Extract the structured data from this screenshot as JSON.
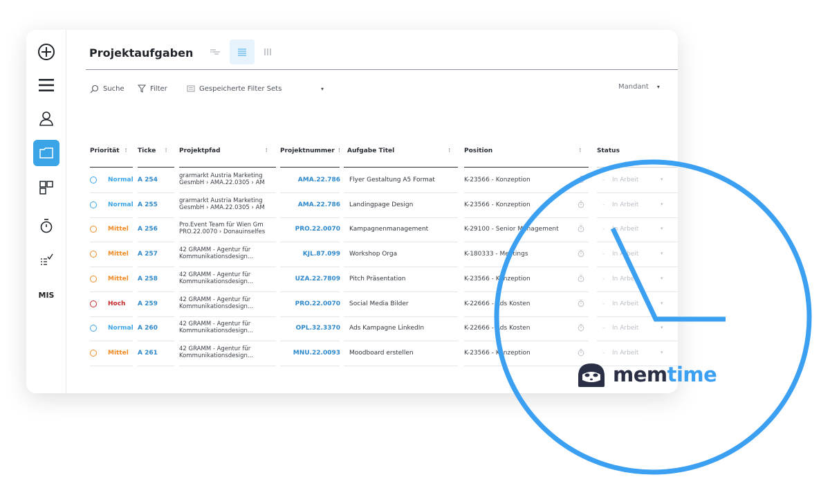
{
  "colors": {
    "accent": "#3aa4e6",
    "link": "#2d88cc",
    "normal": "#3aa4e6",
    "mittel": "#f08a24",
    "hoch": "#c62828",
    "brand_dark": "#2a2f45",
    "brand_blue": "#3b9ff2"
  },
  "sidebar": {
    "icons": [
      "add-circle-icon",
      "menu-icon",
      "user-icon",
      "folder-icon",
      "dashboard-icon",
      "stopwatch-icon",
      "checklist-icon"
    ],
    "mis_label": "MIS"
  },
  "header": {
    "title": "Projektaufgaben",
    "views": [
      "gantt-view-icon",
      "list-view-icon",
      "board-view-icon"
    ]
  },
  "toolbar": {
    "search_label": "Suche",
    "filter_label": "Filter",
    "saved_filters_label": "Gespeicherte Filter Sets",
    "saved_filters_caret": "▾",
    "mandant_label": "Mandant",
    "mandant_caret": "▾"
  },
  "table": {
    "sort_glyph": "⁝",
    "columns": [
      "Priorität",
      "Ticke",
      "Projektpfad",
      "Projektnummer",
      "Aufgabe Titel",
      "Position",
      "Status"
    ],
    "status_dash": "-",
    "caret": "▾",
    "rows": [
      {
        "priority": "Normal",
        "prio_key": "normal",
        "ticket": "A 254",
        "path1": "grarmarkt Austria Marketing",
        "path2": "GesmbH › AMA.22.0305 › AM",
        "pnum": "AMA.22.786",
        "task": "Flyer Gestaltung A5 Format",
        "position": "K-23566 - Konzeption",
        "status": "In Arbeit"
      },
      {
        "priority": "Normal",
        "prio_key": "normal",
        "ticket": "A 255",
        "path1": "grarmarkt Austria Marketing",
        "path2": "GesmbH › AMA.22.0305 › AM",
        "pnum": "AMA.22.786",
        "task": "Landingpage Design",
        "position": "K-23566 - Konzeption",
        "status": "In Arbeit"
      },
      {
        "priority": "Mittel",
        "prio_key": "mittel",
        "ticket": "A 256",
        "path1": "Pro.Event Team für Wien Gm",
        "path2": "PRO.22.0070 › Donauinselfes",
        "pnum": "PRO.22.0070",
        "task": "Kampagnenmanagement",
        "position": "K-29100 - Senior Management",
        "status": "In Arbeit"
      },
      {
        "priority": "Mittel",
        "prio_key": "mittel",
        "ticket": "A 257",
        "path1": "42 GRAMM - Agentur für",
        "path2": "Kommunikationsdesign...",
        "pnum": "KJL.87.099",
        "task": "Workshop Orga",
        "position": "K-180333 - Meetings",
        "status": "In Arbeit"
      },
      {
        "priority": "Mittel",
        "prio_key": "mittel",
        "ticket": "A 258",
        "path1": "42 GRAMM - Agentur für",
        "path2": "Kommunikationsdesign...",
        "pnum": "UZA.22.7809",
        "task": "Pitch Präsentation",
        "position": "K-23566 - Konzeption",
        "status": "In Arbeit"
      },
      {
        "priority": "Hoch",
        "prio_key": "hoch",
        "ticket": "A 259",
        "path1": "42 GRAMM - Agentur für",
        "path2": "Kommunikationsdesign...",
        "pnum": "PRO.22.0070",
        "task": "Social Media Bilder",
        "position": "K-22666 - Ads Kosten",
        "status": "In Arbeit"
      },
      {
        "priority": "Normal",
        "prio_key": "normal",
        "ticket": "A 260",
        "path1": "42 GRAMM - Agentur für",
        "path2": "Kommunikationsdesign...",
        "pnum": "OPL.32.3370",
        "task": "Ads Kampagne LinkedIn",
        "position": "K-22666 - Ads Kosten",
        "status": "In Arbeit"
      },
      {
        "priority": "Mittel",
        "prio_key": "mittel",
        "ticket": "A 261",
        "path1": "42 GRAMM - Agentur für",
        "path2": "Kommunikationsdesign...",
        "pnum": "MNU.22.0093",
        "task": "Moodboard erstellen",
        "position": "K-23566 - Konzeption",
        "status": "In Arbeit"
      }
    ]
  },
  "brand": {
    "name_part1": "mem",
    "name_part2": "time",
    "logo_icon": "sloth-logo-icon"
  }
}
